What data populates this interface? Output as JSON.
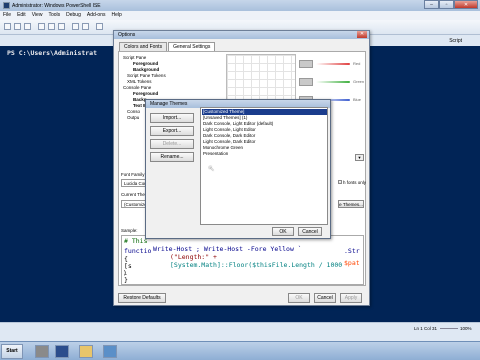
{
  "window": {
    "title": "Administrator: Windows PowerShell ISE",
    "menu": [
      "File",
      "Edit",
      "View",
      "Tools",
      "Debug",
      "Add-ons",
      "Help"
    ],
    "script_label": "Script",
    "prompt": "PS C:\\Users\\Administrat",
    "status_position": "Ln 1  Col 31",
    "zoom": "100%",
    "console_color": "#012456"
  },
  "taskbar": {
    "start_label": "Start"
  },
  "options": {
    "title": "Options",
    "tabs": [
      "Colors and Fonts",
      "General Settings"
    ],
    "tree": [
      "Script Pane",
      "Foreground",
      "Background",
      "Script Pane Tokens",
      "XML Tokens",
      "Console Pane",
      "Foreground",
      "Backg",
      "Text B",
      "Conso",
      "Outpu"
    ],
    "color_labels": [
      "Red",
      "Green",
      "Blue"
    ],
    "font_family_label": "Font Family",
    "font_family_value": "Lucida Con",
    "fonts_only_label": "h fonts only",
    "current_theme_label": "Current Them",
    "current_theme_value": "(Customized",
    "manage_themes_button": "e Themes...",
    "sample_label": "Sample:",
    "sample_code": [
      "# This",
      "functio",
      "{",
      "   [s",
      "   .",
      "      Write-Host ; Write-Host -Fore Yellow `",
      "        (\"Length:\" +",
      "        [System.Math]::Floor($thisFile.Length / 1000",
      "   )",
      "}"
    ],
    "sample_right": [
      ".Str",
      "$pat"
    ],
    "restore_button": "Restore Defaults",
    "ok_button": "OK",
    "cancel_button": "Cancel",
    "apply_button": "Apply"
  },
  "themes": {
    "title": "Manage Themes",
    "buttons": [
      "Import...",
      "Export...",
      "Delete...",
      "Rename..."
    ],
    "list": [
      "[Customized Theme]",
      "[Unsaved Themes] (1)",
      "Dark Console, Light Editor (default)",
      "Light Console, Light Editor",
      "Dark Console, Dark Editor",
      "Light Console, Dark Editor",
      "Monochrome Green",
      "Presentation"
    ],
    "selected_index": 0,
    "ok_button": "OK",
    "cancel_button": "Cancel"
  }
}
